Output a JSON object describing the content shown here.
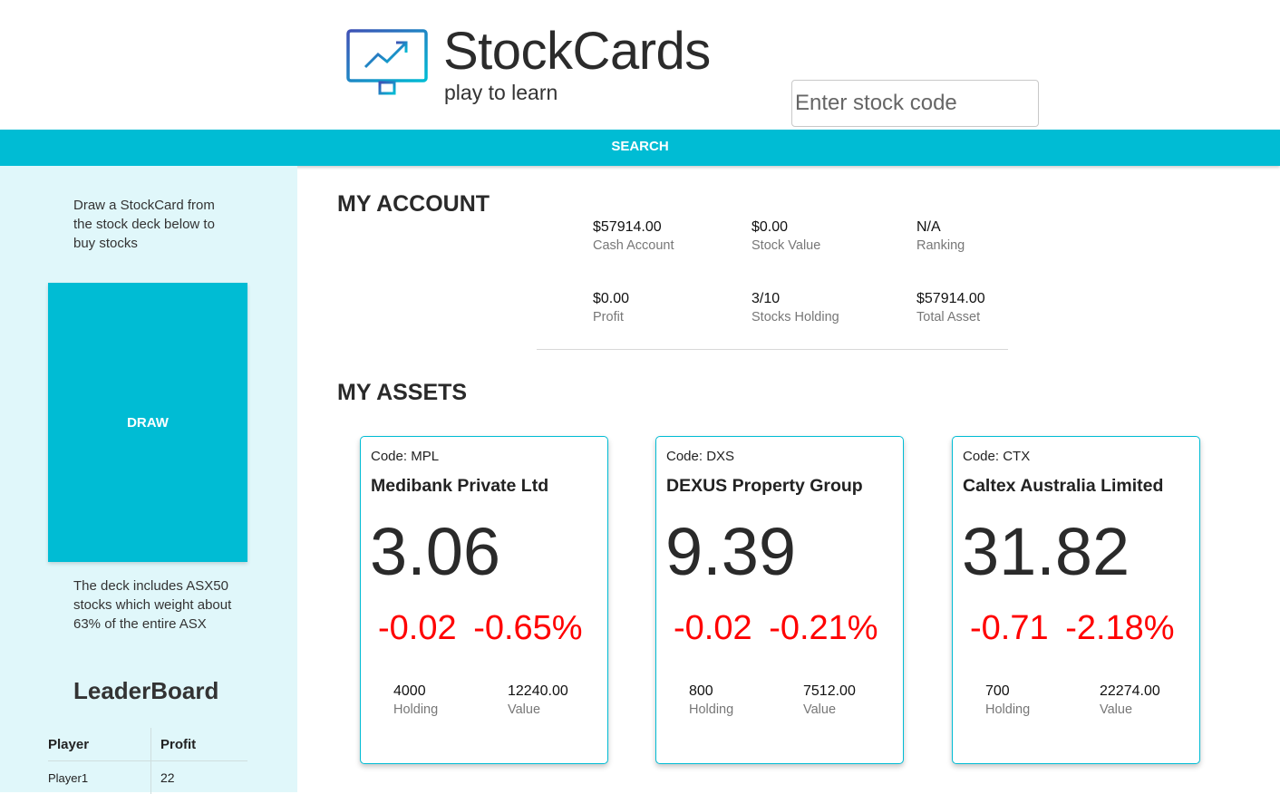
{
  "header": {
    "brand": "StockCards",
    "tagline": "play to learn",
    "search_placeholder": "Enter stock code",
    "search_button": "SEARCH"
  },
  "sidebar": {
    "intro": "Draw a StockCard from the stock deck below to buy stocks",
    "draw_button": "DRAW",
    "deck_note": "The deck includes ASX50 stocks which weight about 63% of the entire ASX",
    "leaderboard": {
      "title": "LeaderBoard",
      "columns": [
        "Player",
        "Profit"
      ],
      "rows": [
        {
          "player": "Player1",
          "profit": "22"
        }
      ]
    }
  },
  "account": {
    "title": "MY ACCOUNT",
    "stats": [
      {
        "value": "$57914.00",
        "label": "Cash Account"
      },
      {
        "value": "$0.00",
        "label": "Stock Value"
      },
      {
        "value": "N/A",
        "label": "Ranking"
      },
      {
        "value": "$0.00",
        "label": "Profit"
      },
      {
        "value": "3/10",
        "label": "Stocks Holding"
      },
      {
        "value": "$57914.00",
        "label": "Total Asset"
      }
    ]
  },
  "assets": {
    "title": "MY ASSETS",
    "cards": [
      {
        "code": "Code: MPL",
        "name": "Medibank Private Ltd",
        "price": "3.06",
        "change": "-0.02",
        "change_pct": "-0.65%",
        "holding": "4000",
        "holding_label": "Holding",
        "value": "12240.00",
        "value_label": "Value"
      },
      {
        "code": "Code: DXS",
        "name": "DEXUS Property Group",
        "price": "9.39",
        "change": "-0.02",
        "change_pct": "-0.21%",
        "holding": "800",
        "holding_label": "Holding",
        "value": "7512.00",
        "value_label": "Value"
      },
      {
        "code": "Code: CTX",
        "name": "Caltex Australia Limited",
        "price": "31.82",
        "change": "-0.71",
        "change_pct": "-2.18%",
        "holding": "700",
        "holding_label": "Holding",
        "value": "22274.00",
        "value_label": "Value"
      }
    ]
  },
  "colors": {
    "accent": "#00bcd4",
    "sidebar_bg": "#e0f7fa",
    "negative": "#ff0000"
  }
}
